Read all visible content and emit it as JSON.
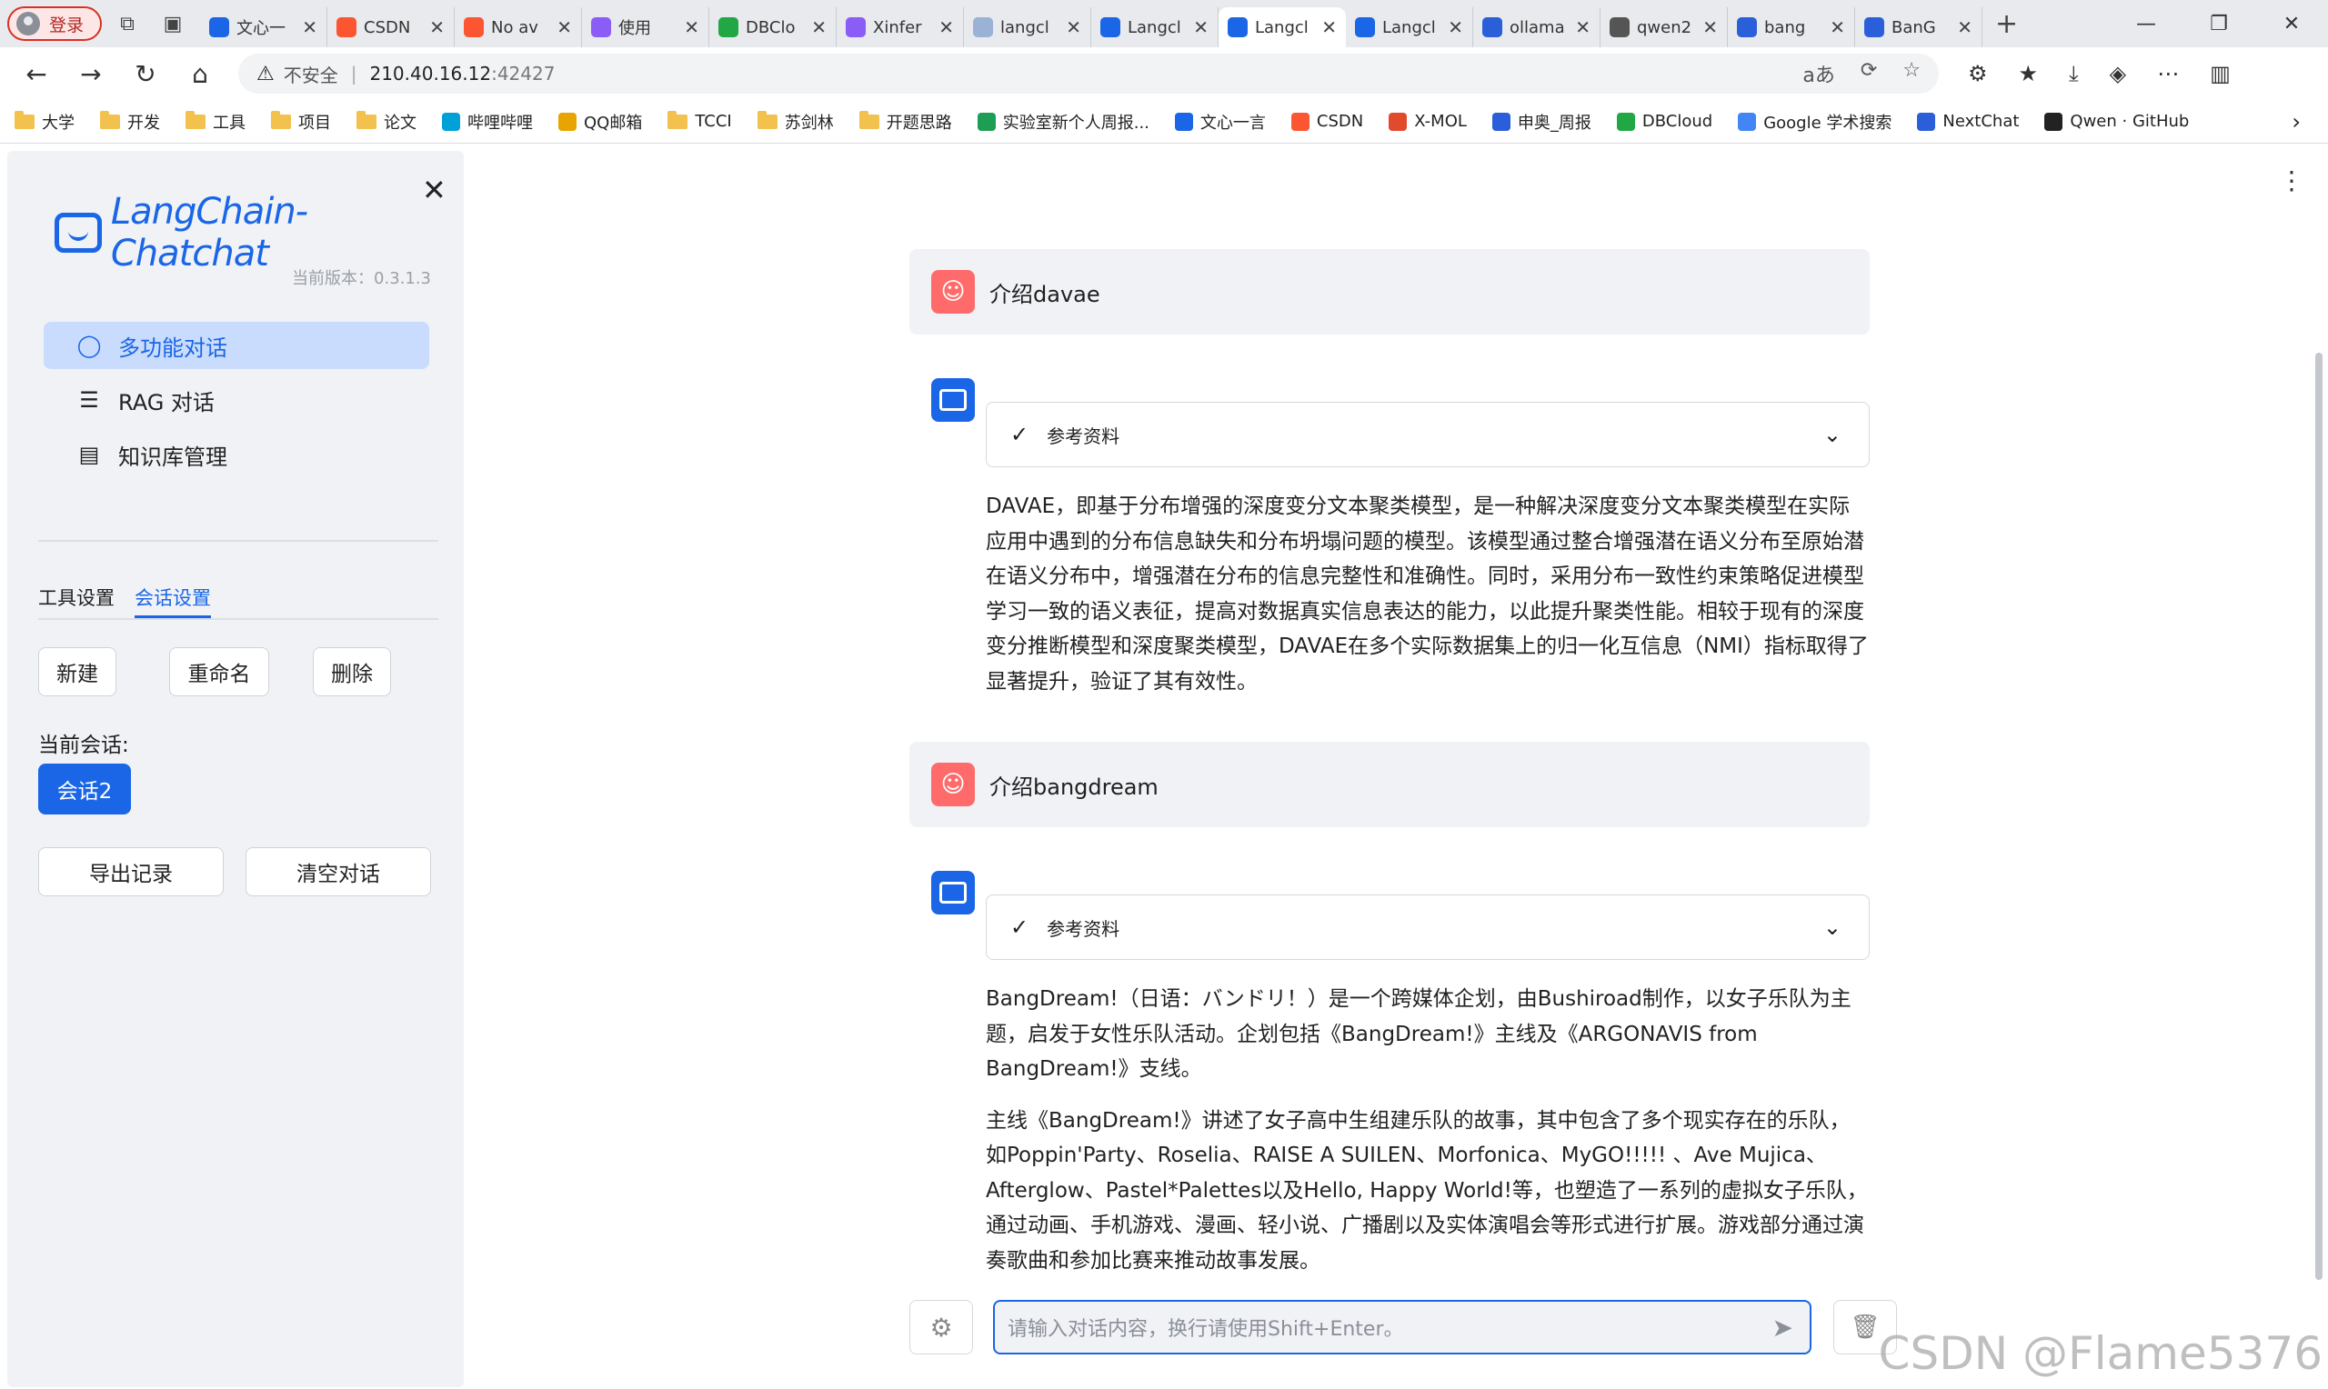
{
  "browser": {
    "profile_label": "登录",
    "tabs": [
      {
        "title": "文心一",
        "icon": "#1a66e6"
      },
      {
        "title": "CSDN",
        "icon": "#fc5531"
      },
      {
        "title": "No av",
        "icon": "#fc5531"
      },
      {
        "title": "使用 ",
        "icon": "#8b5cf6"
      },
      {
        "title": "DBClo",
        "icon": "#22a745"
      },
      {
        "title": "Xinfer",
        "icon": "#8b5cf6"
      },
      {
        "title": "langcl",
        "icon": "#9ab2d6"
      },
      {
        "title": "Langcl",
        "icon": "#1a66e6"
      },
      {
        "title": "Langcl",
        "icon": "#1a66e6"
      },
      {
        "title": "Langcl",
        "icon": "#1a66e6"
      },
      {
        "title": "ollama",
        "icon": "#2b5fd9"
      },
      {
        "title": "qwen2",
        "icon": "#555555"
      },
      {
        "title": "bang",
        "icon": "#2b5fd9"
      },
      {
        "title": "BanG",
        "icon": "#2b5fd9"
      }
    ],
    "active_tab_index": 8,
    "address": {
      "warning": "不安全",
      "host": "210.40.16.12",
      "port": ":42427"
    },
    "bookmarks": [
      {
        "label": "大学",
        "type": "folder"
      },
      {
        "label": "开发",
        "type": "folder"
      },
      {
        "label": "工具",
        "type": "folder"
      },
      {
        "label": "项目",
        "type": "folder"
      },
      {
        "label": "论文",
        "type": "folder"
      },
      {
        "label": "哔哩哔哩",
        "type": "icon",
        "color": "#00a1d6"
      },
      {
        "label": "QQ邮箱",
        "type": "icon",
        "color": "#e8a400"
      },
      {
        "label": "TCCI",
        "type": "folder"
      },
      {
        "label": "苏剑林",
        "type": "folder"
      },
      {
        "label": "开题思路",
        "type": "folder"
      },
      {
        "label": "实验室新个人周报...",
        "type": "icon",
        "color": "#1e9d55"
      },
      {
        "label": "文心一言",
        "type": "icon",
        "color": "#1a66e6"
      },
      {
        "label": "CSDN",
        "type": "icon",
        "color": "#fc5531"
      },
      {
        "label": "X-MOL",
        "type": "icon",
        "color": "#e24a2c"
      },
      {
        "label": "申奥_周报",
        "type": "icon",
        "color": "#2b5fd9"
      },
      {
        "label": "DBCloud",
        "type": "icon",
        "color": "#22a745"
      },
      {
        "label": "Google 学术搜索",
        "type": "icon",
        "color": "#4285f4"
      },
      {
        "label": "NextChat",
        "type": "icon",
        "color": "#2b5fd9"
      },
      {
        "label": "Qwen · GitHub",
        "type": "icon",
        "color": "#222222"
      }
    ]
  },
  "sidebar": {
    "logo_text": "LangChain-Chatchat",
    "version": "当前版本：0.3.1.3",
    "menu": [
      {
        "label": "多功能对话",
        "icon": "chat-bubble-icon",
        "active": true
      },
      {
        "label": "RAG 对话",
        "icon": "database-icon",
        "active": false
      },
      {
        "label": "知识库管理",
        "icon": "server-icon",
        "active": false
      }
    ],
    "settings_tabs": [
      "工具设置",
      "会话设置"
    ],
    "active_settings_tab": 1,
    "buttons": {
      "new": "新建",
      "rename": "重命名",
      "delete": "删除"
    },
    "current_session_label": "当前会话:",
    "current_session": "会话2",
    "export": "导出记录",
    "clear": "清空对话"
  },
  "chat": {
    "messages": [
      {
        "role": "user",
        "text": "介绍davae"
      },
      {
        "role": "assistant",
        "ref_label": "参考资料",
        "paragraphs": [
          "DAVAE，即基于分布增强的深度变分文本聚类模型，是一种解决深度变分文本聚类模型在实际应用中遇到的分布信息缺失和分布坍塌问题的模型。该模型通过整合增强潜在语义分布至原始潜在语义分布中，增强潜在分布的信息完整性和准确性。同时，采用分布一致性约束策略促进模型学习一致的语义表征，提高对数据真实信息表达的能力，以此提升聚类性能。相较于现有的深度变分推断模型和深度聚类模型，DAVAE在多个实际数据集上的归一化互信息（NMI）指标取得了显著提升，验证了其有效性。"
        ]
      },
      {
        "role": "user",
        "text": "介绍bangdream"
      },
      {
        "role": "assistant",
        "ref_label": "参考资料",
        "paragraphs": [
          "BangDream!（日语：バンドリ！）是一个跨媒体企划，由Bushiroad制作，以女子乐队为主题，启发于女性乐队活动。企划包括《BangDream!》主线及《ARGONAVIS from BangDream!》支线。",
          "主线《BangDream!》讲述了女子高中生组建乐队的故事，其中包含了多个现实存在的乐队，如Poppin'Party、Roselia、RAISE A SUILEN、Morfonica、MyGO!!!!! 、Ave Mujica、Afterglow、Pastel*Palettes以及Hello, Happy World!等，也塑造了一系列的虚拟女子乐队，通过动画、手机游戏、漫画、轻小说、广播剧以及实体演唱会等形式进行扩展。游戏部分通过演奏歌曲和参加比赛来推动故事发展。"
        ]
      }
    ],
    "input_placeholder": "请输入对话内容，换行请使用Shift+Enter。"
  },
  "watermark": "CSDN @Flame5376",
  "colors": {
    "accent": "#1a66e6",
    "user_avatar": "#ff6b6b",
    "sidebar_bg": "#f0f2f6"
  }
}
